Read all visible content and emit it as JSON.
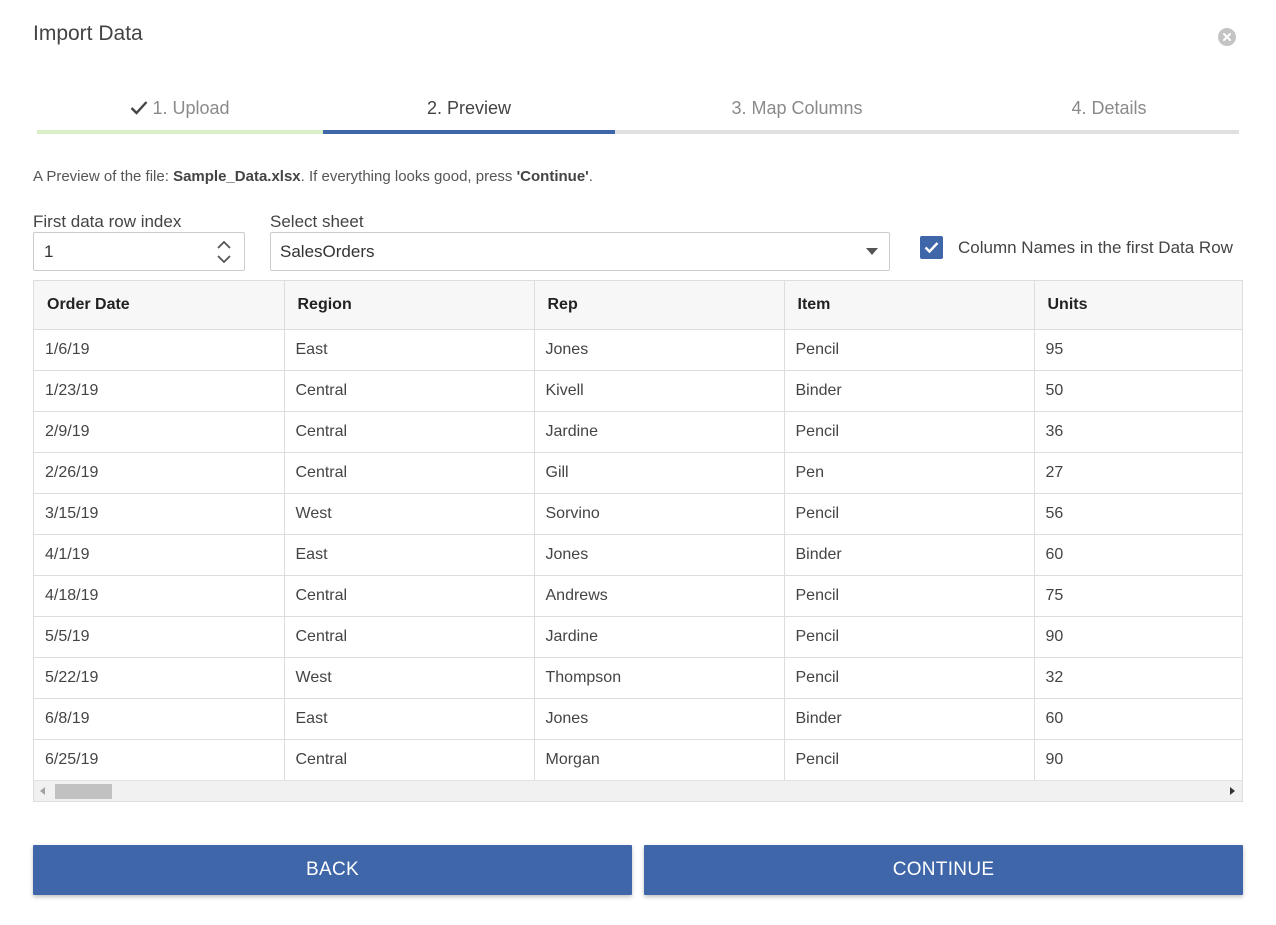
{
  "dialog": {
    "title": "Import Data",
    "close_icon": "close-circle-icon"
  },
  "steps": [
    {
      "label": "1. Upload",
      "state": "done"
    },
    {
      "label": "2. Preview",
      "state": "active"
    },
    {
      "label": "3. Map Columns",
      "state": "pending"
    },
    {
      "label": "4. Details",
      "state": "pending"
    }
  ],
  "description": {
    "prefix": "A Preview of the file: ",
    "filename": "Sample_Data.xlsx",
    "middle": ". If everything looks good, press ",
    "quoted": "'Continue'",
    "suffix": "."
  },
  "first_row": {
    "label": "First data row index",
    "value": "1"
  },
  "sheet": {
    "label": "Select sheet",
    "value": "SalesOrders"
  },
  "column_names_checkbox": {
    "label": "Column Names in the first Data Row",
    "checked": true
  },
  "table": {
    "headers": [
      "Order Date",
      "Region",
      "Rep",
      "Item",
      "Units"
    ],
    "rows": [
      [
        "1/6/19",
        "East",
        "Jones",
        "Pencil",
        "95"
      ],
      [
        "1/23/19",
        "Central",
        "Kivell",
        "Binder",
        "50"
      ],
      [
        "2/9/19",
        "Central",
        "Jardine",
        "Pencil",
        "36"
      ],
      [
        "2/26/19",
        "Central",
        "Gill",
        "Pen",
        "27"
      ],
      [
        "3/15/19",
        "West",
        "Sorvino",
        "Pencil",
        "56"
      ],
      [
        "4/1/19",
        "East",
        "Jones",
        "Binder",
        "60"
      ],
      [
        "4/18/19",
        "Central",
        "Andrews",
        "Pencil",
        "75"
      ],
      [
        "5/5/19",
        "Central",
        "Jardine",
        "Pencil",
        "90"
      ],
      [
        "5/22/19",
        "West",
        "Thompson",
        "Pencil",
        "32"
      ],
      [
        "6/8/19",
        "East",
        "Jones",
        "Binder",
        "60"
      ],
      [
        "6/25/19",
        "Central",
        "Morgan",
        "Pencil",
        "90"
      ]
    ]
  },
  "buttons": {
    "back": "BACK",
    "continue": "CONTINUE"
  },
  "colors": {
    "accent": "#3f66a9",
    "step_done": "#d8efc8",
    "step_pending": "#e0e0e0"
  }
}
